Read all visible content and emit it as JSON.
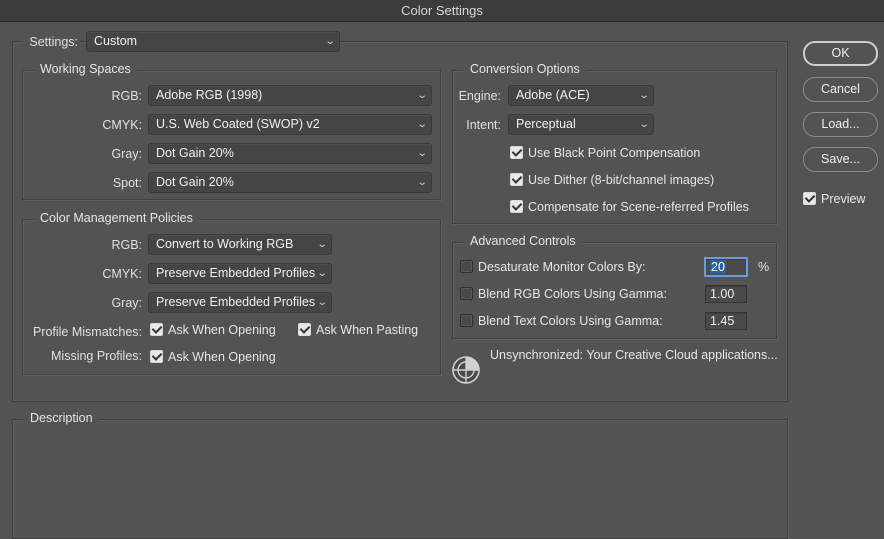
{
  "window": {
    "title": "Color Settings"
  },
  "settings": {
    "label": "Settings:",
    "value": "Custom"
  },
  "working_spaces": {
    "legend": "Working Spaces",
    "rows": [
      {
        "label": "RGB:",
        "value": "Adobe RGB (1998)"
      },
      {
        "label": "CMYK:",
        "value": "U.S. Web Coated (SWOP) v2"
      },
      {
        "label": "Gray:",
        "value": "Dot Gain 20%"
      },
      {
        "label": "Spot:",
        "value": "Dot Gain 20%"
      }
    ]
  },
  "policies": {
    "legend": "Color Management Policies",
    "rows": [
      {
        "label": "RGB:",
        "value": "Convert to Working RGB"
      },
      {
        "label": "CMYK:",
        "value": "Preserve Embedded Profiles"
      },
      {
        "label": "Gray:",
        "value": "Preserve Embedded Profiles"
      }
    ],
    "mismatch_label": "Profile Mismatches:",
    "mismatch_open": {
      "label": "Ask When Opening",
      "checked": true
    },
    "mismatch_paste": {
      "label": "Ask When Pasting",
      "checked": true
    },
    "missing_label": "Missing Profiles:",
    "missing_open": {
      "label": "Ask When Opening",
      "checked": true
    }
  },
  "conversion": {
    "legend": "Conversion Options",
    "engine_label": "Engine:",
    "engine_value": "Adobe (ACE)",
    "intent_label": "Intent:",
    "intent_value": "Perceptual",
    "checks": [
      {
        "label": "Use Black Point Compensation",
        "checked": true
      },
      {
        "label": "Use Dither (8-bit/channel images)",
        "checked": true
      },
      {
        "label": "Compensate for Scene-referred Profiles",
        "checked": true
      }
    ]
  },
  "advanced": {
    "legend": "Advanced Controls",
    "desaturate": {
      "label": "Desaturate Monitor Colors By:",
      "value": "20",
      "unit": "%"
    },
    "blend_rgb": {
      "label": "Blend RGB Colors Using Gamma:",
      "value": "1.00"
    },
    "blend_text": {
      "label": "Blend Text Colors Using Gamma:",
      "value": "1.45"
    }
  },
  "sync": {
    "icon": "sync-status-icon",
    "message": "Unsynchronized: Your Creative Cloud applications..."
  },
  "description": {
    "legend": "Description"
  },
  "buttons": {
    "ok": "OK",
    "cancel": "Cancel",
    "load": "Load...",
    "save": "Save..."
  },
  "preview": {
    "label": "Preview",
    "checked": true
  }
}
